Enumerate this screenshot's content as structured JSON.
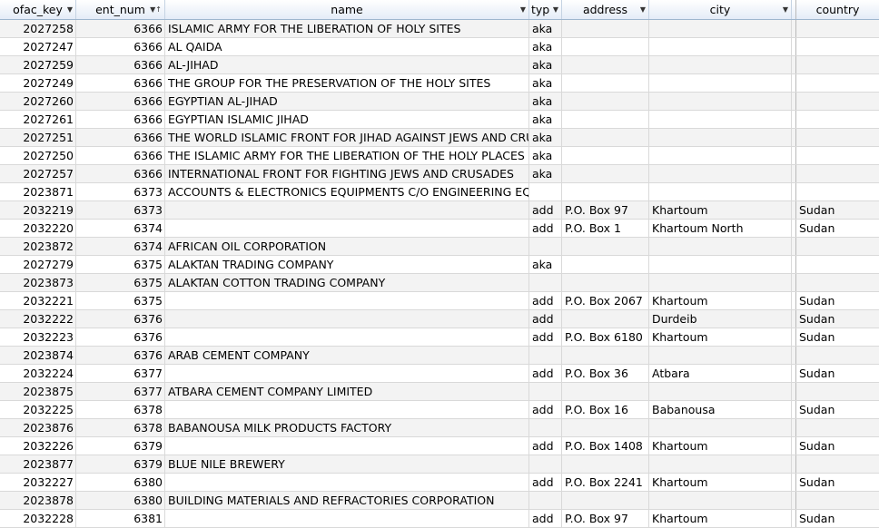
{
  "columns": {
    "ofac_key": "ofac_key",
    "ent_num": "ent_num",
    "name": "name",
    "type": "typ",
    "address": "address",
    "city": "city",
    "country": "country"
  },
  "icons": {
    "filter": "dropdown-arrow-icon",
    "sort_filter": "sort-ascending-filter-icon"
  },
  "rows": [
    {
      "ofac_key": "2027258",
      "ent_num": "6366",
      "name": "ISLAMIC ARMY FOR THE LIBERATION OF HOLY SITES",
      "type": "aka",
      "address": "",
      "city": "",
      "country": ""
    },
    {
      "ofac_key": "2027247",
      "ent_num": "6366",
      "name": "AL QAIDA",
      "type": "aka",
      "address": "",
      "city": "",
      "country": ""
    },
    {
      "ofac_key": "2027259",
      "ent_num": "6366",
      "name": "AL-JIHAD",
      "type": "aka",
      "address": "",
      "city": "",
      "country": ""
    },
    {
      "ofac_key": "2027249",
      "ent_num": "6366",
      "name": "THE GROUP FOR THE PRESERVATION OF THE HOLY SITES",
      "type": "aka",
      "address": "",
      "city": "",
      "country": ""
    },
    {
      "ofac_key": "2027260",
      "ent_num": "6366",
      "name": "EGYPTIAN AL-JIHAD",
      "type": "aka",
      "address": "",
      "city": "",
      "country": ""
    },
    {
      "ofac_key": "2027261",
      "ent_num": "6366",
      "name": "EGYPTIAN ISLAMIC JIHAD",
      "type": "aka",
      "address": "",
      "city": "",
      "country": ""
    },
    {
      "ofac_key": "2027251",
      "ent_num": "6366",
      "name": "THE WORLD ISLAMIC FRONT FOR JIHAD AGAINST JEWS AND CRUS",
      "type": "aka",
      "address": "",
      "city": "",
      "country": ""
    },
    {
      "ofac_key": "2027250",
      "ent_num": "6366",
      "name": "THE ISLAMIC ARMY FOR THE LIBERATION OF THE HOLY PLACES",
      "type": "aka",
      "address": "",
      "city": "",
      "country": ""
    },
    {
      "ofac_key": "2027257",
      "ent_num": "6366",
      "name": "INTERNATIONAL FRONT FOR FIGHTING JEWS AND CRUSADES",
      "type": "aka",
      "address": "",
      "city": "",
      "country": ""
    },
    {
      "ofac_key": "2023871",
      "ent_num": "6373",
      "name": "ACCOUNTS & ELECTRONICS EQUIPMENTS C/O ENGINEERING EQUI",
      "type": "",
      "address": "",
      "city": "",
      "country": ""
    },
    {
      "ofac_key": "2032219",
      "ent_num": "6373",
      "name": "",
      "type": "add",
      "address": "P.O. Box 97",
      "city": "Khartoum",
      "country": "Sudan"
    },
    {
      "ofac_key": "2032220",
      "ent_num": "6374",
      "name": "",
      "type": "add",
      "address": "P.O. Box 1",
      "city": "Khartoum North",
      "country": "Sudan"
    },
    {
      "ofac_key": "2023872",
      "ent_num": "6374",
      "name": "AFRICAN OIL CORPORATION",
      "type": "",
      "address": "",
      "city": "",
      "country": ""
    },
    {
      "ofac_key": "2027279",
      "ent_num": "6375",
      "name": "ALAKTAN TRADING COMPANY",
      "type": "aka",
      "address": "",
      "city": "",
      "country": ""
    },
    {
      "ofac_key": "2023873",
      "ent_num": "6375",
      "name": "ALAKTAN COTTON TRADING COMPANY",
      "type": "",
      "address": "",
      "city": "",
      "country": ""
    },
    {
      "ofac_key": "2032221",
      "ent_num": "6375",
      "name": "",
      "type": "add",
      "address": "P.O. Box 2067",
      "city": "Khartoum",
      "country": "Sudan"
    },
    {
      "ofac_key": "2032222",
      "ent_num": "6376",
      "name": "",
      "type": "add",
      "address": "",
      "city": "Durdeib",
      "country": "Sudan"
    },
    {
      "ofac_key": "2032223",
      "ent_num": "6376",
      "name": "",
      "type": "add",
      "address": "P.O. Box 6180",
      "city": "Khartoum",
      "country": "Sudan"
    },
    {
      "ofac_key": "2023874",
      "ent_num": "6376",
      "name": "ARAB CEMENT COMPANY",
      "type": "",
      "address": "",
      "city": "",
      "country": ""
    },
    {
      "ofac_key": "2032224",
      "ent_num": "6377",
      "name": "",
      "type": "add",
      "address": "P.O. Box 36",
      "city": "Atbara",
      "country": "Sudan"
    },
    {
      "ofac_key": "2023875",
      "ent_num": "6377",
      "name": "ATBARA CEMENT COMPANY LIMITED",
      "type": "",
      "address": "",
      "city": "",
      "country": ""
    },
    {
      "ofac_key": "2032225",
      "ent_num": "6378",
      "name": "",
      "type": "add",
      "address": "P.O. Box 16",
      "city": "Babanousa",
      "country": "Sudan"
    },
    {
      "ofac_key": "2023876",
      "ent_num": "6378",
      "name": "BABANOUSA MILK PRODUCTS FACTORY",
      "type": "",
      "address": "",
      "city": "",
      "country": ""
    },
    {
      "ofac_key": "2032226",
      "ent_num": "6379",
      "name": "",
      "type": "add",
      "address": "P.O. Box 1408",
      "city": "Khartoum",
      "country": "Sudan"
    },
    {
      "ofac_key": "2023877",
      "ent_num": "6379",
      "name": "BLUE NILE BREWERY",
      "type": "",
      "address": "",
      "city": "",
      "country": ""
    },
    {
      "ofac_key": "2032227",
      "ent_num": "6380",
      "name": "",
      "type": "add",
      "address": "P.O. Box 2241",
      "city": "Khartoum",
      "country": "Sudan"
    },
    {
      "ofac_key": "2023878",
      "ent_num": "6380",
      "name": "BUILDING MATERIALS AND REFRACTORIES CORPORATION",
      "type": "",
      "address": "",
      "city": "",
      "country": ""
    },
    {
      "ofac_key": "2032228",
      "ent_num": "6381",
      "name": "",
      "type": "add",
      "address": "P.O. Box 97",
      "city": "Khartoum",
      "country": "Sudan"
    }
  ]
}
